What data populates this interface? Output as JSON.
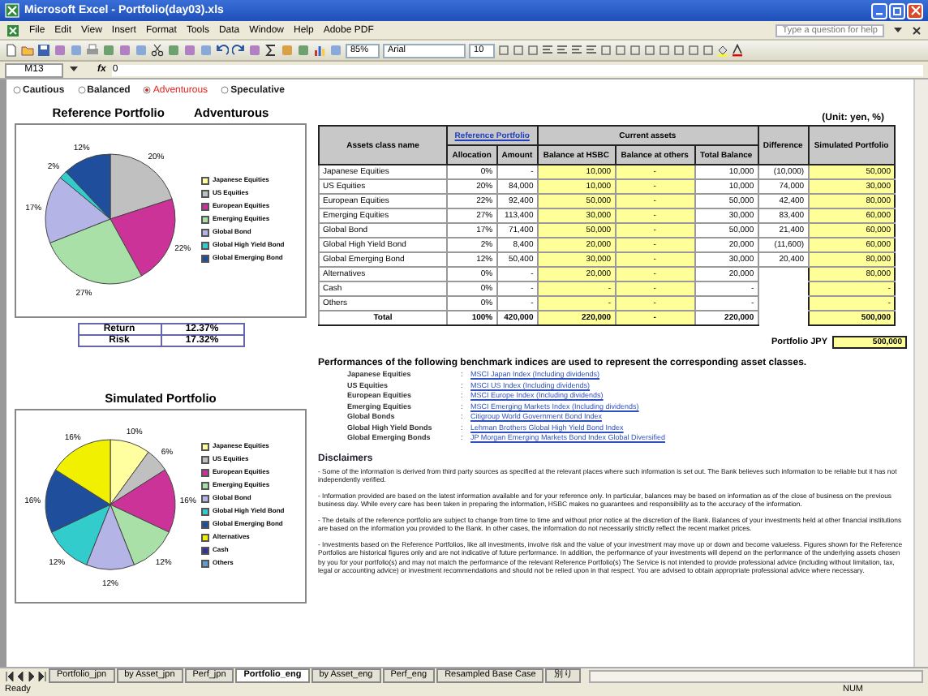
{
  "window": {
    "title": "Microsoft Excel - Portfolio(day03).xls"
  },
  "menu": [
    "File",
    "Edit",
    "View",
    "Insert",
    "Format",
    "Tools",
    "Data",
    "Window",
    "Help",
    "Adobe PDF"
  ],
  "help_field": {
    "placeholder": "Type a question for help"
  },
  "toolbar": {
    "zoom": "85%",
    "font": "Arial",
    "size": "10"
  },
  "formula_bar": {
    "cell": "M13",
    "fx": "fx",
    "value": "0"
  },
  "profiles": [
    {
      "label": "Cautious",
      "selected": false
    },
    {
      "label": "Balanced",
      "selected": false
    },
    {
      "label": "Adventurous",
      "selected": true
    },
    {
      "label": "Speculative",
      "selected": false
    }
  ],
  "reference": {
    "profile_label": "Adventurous",
    "chart_data": {
      "type": "pie",
      "title": "Reference Portfolio",
      "categories": [
        "Japanese Equities",
        "US Equities",
        "European Equities",
        "Emerging Equities",
        "Global Bond",
        "Global High Yield Bond",
        "Global Emerging Bond"
      ],
      "series": [
        {
          "values": [
            0,
            20,
            22,
            27,
            17,
            2,
            12
          ]
        }
      ],
      "legend": true,
      "colors": [
        "#ffffa0",
        "#c0c0c0",
        "#cc3399",
        "#a8e0a8",
        "#b4b4e6",
        "#33cccc",
        "#1f4e9c"
      ],
      "value_labels": [
        null,
        "20%",
        "22%",
        "27%",
        "17%",
        "2%",
        "12%"
      ]
    },
    "stats": [
      {
        "label": "Return",
        "value": "12.37%"
      },
      {
        "label": "Risk",
        "value": "17.32%"
      }
    ]
  },
  "simulated": {
    "chart_data": {
      "type": "pie",
      "title": "Simulated Portfolio",
      "categories": [
        "Japanese Equities",
        "US Equities",
        "European Equities",
        "Emerging Equities",
        "Global Bond",
        "Global High Yield Bond",
        "Global Emerging Bond",
        "Alternatives",
        "Cash",
        "Others"
      ],
      "series": [
        {
          "values": [
            10,
            6,
            16,
            12,
            12,
            12,
            16,
            16,
            0,
            0
          ]
        }
      ],
      "legend": true,
      "colors": [
        "#ffffa0",
        "#c0c0c0",
        "#cc3399",
        "#a8e0a8",
        "#b4b4e6",
        "#33cccc",
        "#1f4e9c",
        "#f0f000",
        "#333399",
        "#6699cc"
      ],
      "value_labels": [
        "10%",
        "6%",
        "16%",
        "12%",
        "12%",
        "12%",
        "16%",
        "16%",
        null,
        null
      ]
    }
  },
  "unit_note": "(Unit: yen, %)",
  "table": {
    "headers": {
      "name": "Assets class name",
      "reference": "Reference Portfolio",
      "current": "Current assets",
      "difference": "Difference",
      "simulated": "Simulated Portfolio",
      "allocation": "Allocation",
      "amount": "Amount",
      "hsbc": "Balance at HSBC",
      "others": "Balance at others",
      "total": "Total Balance"
    },
    "rows": [
      {
        "kind": "asset",
        "name": "Japanese Equities",
        "allocation": "0%",
        "amount": "-",
        "hsbc": "10,000",
        "others": "-",
        "total": "10,000",
        "difference": "(10,000)",
        "simulated": "50,000"
      },
      {
        "kind": "asset",
        "name": "US Equities",
        "allocation": "20%",
        "amount": "84,000",
        "hsbc": "10,000",
        "others": "-",
        "total": "10,000",
        "difference": "74,000",
        "simulated": "30,000"
      },
      {
        "kind": "asset",
        "name": "European Equities",
        "allocation": "22%",
        "amount": "92,400",
        "hsbc": "50,000",
        "others": "-",
        "total": "50,000",
        "difference": "42,400",
        "simulated": "80,000"
      },
      {
        "kind": "asset",
        "name": "Emerging Equities",
        "allocation": "27%",
        "amount": "113,400",
        "hsbc": "30,000",
        "others": "-",
        "total": "30,000",
        "difference": "83,400",
        "simulated": "60,000"
      },
      {
        "kind": "asset",
        "name": "Global Bond",
        "allocation": "17%",
        "amount": "71,400",
        "hsbc": "50,000",
        "others": "-",
        "total": "50,000",
        "difference": "21,400",
        "simulated": "60,000"
      },
      {
        "kind": "asset",
        "name": "Global High Yield Bond",
        "allocation": "2%",
        "amount": "8,400",
        "hsbc": "20,000",
        "others": "-",
        "total": "20,000",
        "difference": "(11,600)",
        "simulated": "60,000"
      },
      {
        "kind": "asset",
        "name": "Global Emerging Bond",
        "allocation": "12%",
        "amount": "50,400",
        "hsbc": "30,000",
        "others": "-",
        "total": "30,000",
        "difference": "20,400",
        "simulated": "80,000"
      },
      {
        "kind": "asset",
        "name": "Alternatives",
        "allocation": "0%",
        "amount": "-",
        "hsbc": "20,000",
        "others": "-",
        "total": "20,000",
        "simulated": "80,000"
      },
      {
        "kind": "asset",
        "name": "Cash",
        "allocation": "0%",
        "amount": "-",
        "hsbc": "-",
        "others": "-",
        "total": "-",
        "simulated": "-"
      },
      {
        "kind": "asset",
        "name": "Others",
        "allocation": "0%",
        "amount": "-",
        "hsbc": "-",
        "others": "-",
        "total": "-",
        "simulated": "-"
      },
      {
        "kind": "total",
        "name": "Total",
        "allocation": "100%",
        "amount": "420,000",
        "hsbc": "220,000",
        "others": "-",
        "total": "220,000",
        "simulated": "500,000"
      }
    ]
  },
  "portfolio_jpy": {
    "label": "Portfolio JPY",
    "value": "500,000"
  },
  "benchmarks": {
    "title": "Performances of the following benchmark indices are used to represent the corresponding asset classes.",
    "rows": [
      {
        "asset": "Japanese Equities",
        "sep": ":",
        "index": "MSCI Japan Index (Including dividends)"
      },
      {
        "asset": "US Equities",
        "sep": ":",
        "index": "MSCI US Index (Including dividends)"
      },
      {
        "asset": "European Equities",
        "sep": ":",
        "index": "MSCI Europe Index (Including dividends)"
      },
      {
        "asset": "Emerging Equities",
        "sep": ":",
        "index": "MSCI Emerging Markets Index (Including dividends)"
      },
      {
        "asset": "Global Bonds",
        "sep": ":",
        "index": "Citigroup World Government Bond Index"
      },
      {
        "asset": "Global High Yield Bonds",
        "sep": ":",
        "index": "Lehman Brothers Global High Yield Bond Index"
      },
      {
        "asset": "Global Emerging Bonds",
        "sep": ":",
        "index": "JP Morgan Emerging Markets Bond Index Global Diversified"
      }
    ]
  },
  "disclaimers": {
    "title": "Disclaimers",
    "paragraphs": [
      "- Some of the information is derived from third party sources as specified at the relevant places where such information is set out. The Bank believes such information to be reliable but it has not independently verified.",
      "- Information provided are based on the latest information available and for your reference only.  In particular, balances may be based on information as of the close of business on the previous business day. While every care has been taken in preparing the information, HSBC makes no guarantees and responsibility as to the accuracy of the information.",
      "- The details of the reference portfolio are subject to change from time to time and without prior notice at the discretion of the Bank.  Balances of your investments held at other financial institutions are based on the information you provided to the Bank. In other cases, the information do not necessarily strictly reflect the recent market prices.",
      "- Investments based on the Reference Portfolios, like all investments, involve risk and the value of your investment may move up or down and become valueless. Figures shown for the Reference Portfolios are historical figures only and are not indicative of future performance. In addition, the performance of your investments will depend on the performance of the underlying assets chosen by you for your portfolio(s) and may not match the performance of the relevant Reference Portfolio(s) The Service is not intended to provide professional advice (including without limitation, tax, legal or accounting advice) or investment recommendations and should not be relied upon in that respect. You are advised to obtain appropriate professional advice where necessary."
    ]
  },
  "sheet_tabs": [
    {
      "label": "Portfolio_jpn",
      "selected": false
    },
    {
      "label": "by Asset_jpn",
      "selected": false
    },
    {
      "label": "Perf_jpn",
      "selected": false
    },
    {
      "label": "Portfolio_eng",
      "selected": true
    },
    {
      "label": "by Asset_eng",
      "selected": false
    },
    {
      "label": "Perf_eng",
      "selected": false
    },
    {
      "label": "Resampled Base Case",
      "selected": false
    },
    {
      "label": "別り",
      "selected": false
    }
  ],
  "status_bar": {
    "left": "Ready",
    "right": "NUM"
  }
}
